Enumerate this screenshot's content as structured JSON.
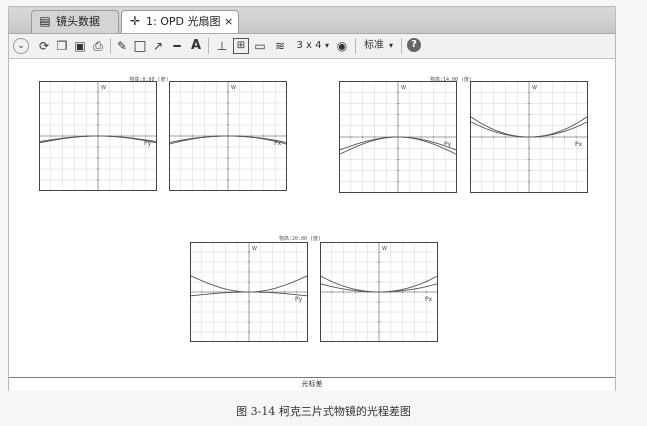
{
  "tabs": [
    {
      "label": "镜头数据",
      "icon": "document-icon",
      "active": false
    },
    {
      "label": "1: OPD 光扇图",
      "icon": "crosshair-icon",
      "active": true,
      "close": "×"
    }
  ],
  "toolbar": {
    "layout_label": "3 x 4",
    "standard_label": "标准",
    "dropdown_glyph": "▾"
  },
  "field_titles": [
    "物高:0.00 (度)",
    "物高:14.00 (度)",
    "物高:20.00 (度)"
  ],
  "axis_labels": {
    "py": "Py",
    "px": "Px",
    "w": "W"
  },
  "status_label": "光标差",
  "caption": "图 3-14   柯克三片式物镜的光程差图",
  "colors": {
    "curve": "#555555",
    "grid": "#d6d6d6",
    "axis": "#8a8a8a"
  }
}
